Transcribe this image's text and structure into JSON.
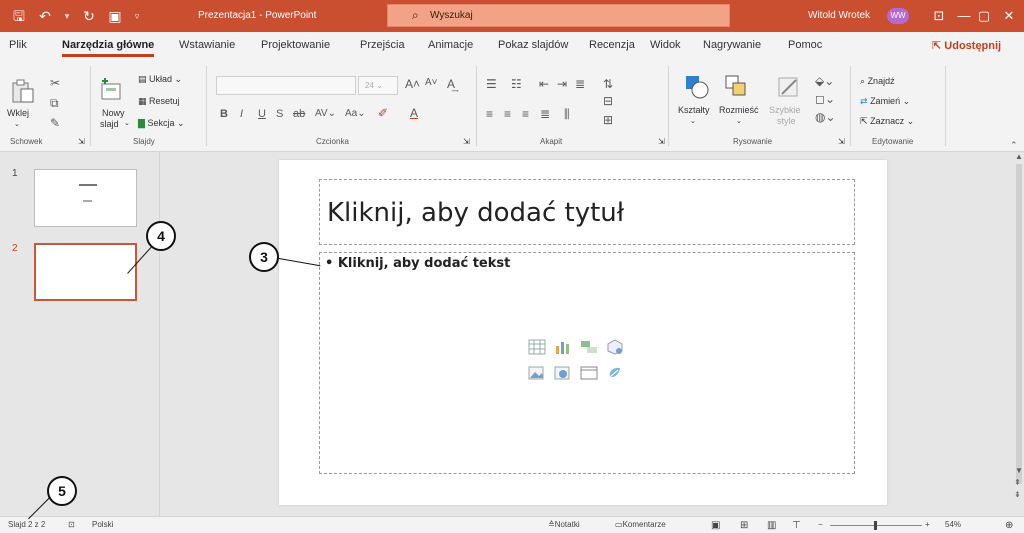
{
  "window": {
    "doc_title": "Prezentacja1 - PowerPoint",
    "search_placeholder": "Wyszukaj",
    "user_name": "Witold Wrotek",
    "user_initials": "WW"
  },
  "tabs": [
    "Plik",
    "Narzędzia główne",
    "Wstawianie",
    "Projektowanie",
    "Przejścia",
    "Animacje",
    "Pokaz slajdów",
    "Recenzja",
    "Widok",
    "Nagrywanie",
    "Pomoc"
  ],
  "active_tab": "Narzędzia główne",
  "share_label": "Udostępnij",
  "ribbon": {
    "groups": {
      "clipboard": "Schowek",
      "slides": "Slajdy",
      "font": "Czcionka",
      "paragraph": "Akapit",
      "drawing": "Rysowanie",
      "editing": "Edytowanie"
    },
    "paste_label": "Wklej",
    "new_slide_label_1": "Nowy",
    "new_slide_label_2": "slajd",
    "layout_label": "Układ",
    "reset_label": "Resetuj",
    "section_label": "Sekcja",
    "font_size": "24",
    "shapes_label": "Kształty",
    "arrange_label": "Rozmieść",
    "quick_styles_label_1": "Szybkie",
    "quick_styles_label_2": "style",
    "find_label": "Znajdź",
    "replace_label": "Zamień",
    "select_label": "Zaznacz"
  },
  "slides_pane": {
    "slide1_number": "1",
    "slide2_number": "2"
  },
  "slide": {
    "title_placeholder": "Kliknij, aby dodać tytuł",
    "body_placeholder": "• Kliknij, aby dodać tekst"
  },
  "status": {
    "slide_info": "Slajd 2 z 2",
    "language": "Polski",
    "notes": "Notatki",
    "comments": "Komentarze",
    "zoom": "54%"
  },
  "callouts": {
    "c3": "3",
    "c4": "4",
    "c5": "5"
  },
  "colors": {
    "accent": "#c43e1c",
    "titlebar": "#c94f30"
  }
}
